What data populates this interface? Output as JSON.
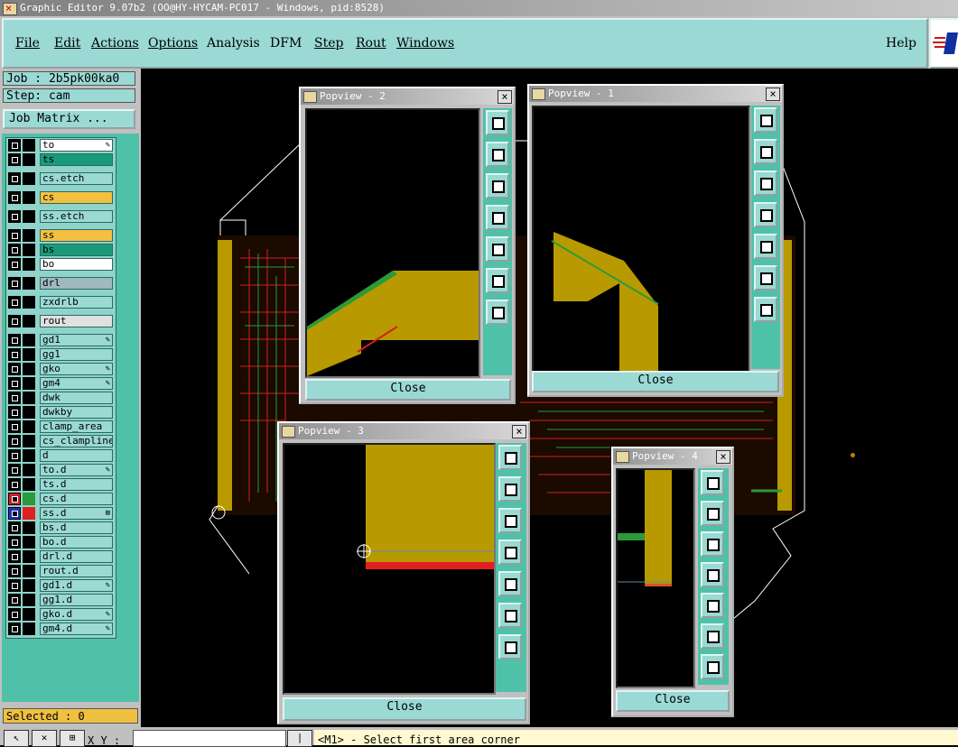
{
  "window": {
    "title": "Graphic Editor 9.07b2 (OO@HY-HYCAM-PC017 - Windows, pid:8528)"
  },
  "menu": {
    "file": "File",
    "edit": "Edit",
    "actions": "Actions",
    "options": "Options",
    "analysis": "Analysis",
    "dfm": "DFM",
    "step": "Step",
    "rout": "Rout",
    "windows": "Windows",
    "help": "Help"
  },
  "job": {
    "label": "Job : 2b5pk00ka0",
    "step_label": "Step: cam",
    "matrix_button": "Job Matrix ..."
  },
  "layers": [
    {
      "name": "to",
      "color": "#ffffff",
      "mark": "✎"
    },
    {
      "name": "ts",
      "color": "#1a9a7a",
      "mark": ""
    },
    {
      "name": "cs.etch",
      "color": "#9ad9d4",
      "mark": ""
    },
    {
      "name": "cs",
      "color": "#f4c040",
      "mark": ""
    },
    {
      "name": "ss.etch",
      "color": "#9ad9d4",
      "mark": ""
    },
    {
      "name": "ss",
      "color": "#f4c040",
      "mark": ""
    },
    {
      "name": "bs",
      "color": "#1a9a7a",
      "mark": ""
    },
    {
      "name": "bo",
      "color": "#ffffff",
      "mark": ""
    },
    {
      "name": "drl",
      "color": "#a0b8c0",
      "mark": ""
    },
    {
      "name": "zxdrlb",
      "color": "#9ad9d4",
      "mark": ""
    },
    {
      "name": "rout",
      "color": "#e0e0e0",
      "mark": ""
    },
    {
      "name": "gd1",
      "color": "#9ad9d4",
      "mark": "✎"
    },
    {
      "name": "gg1",
      "color": "#9ad9d4",
      "mark": ""
    },
    {
      "name": "gko",
      "color": "#9ad9d4",
      "mark": "✎"
    },
    {
      "name": "gm4",
      "color": "#9ad9d4",
      "mark": "✎"
    },
    {
      "name": "dwk",
      "color": "#9ad9d4",
      "mark": ""
    },
    {
      "name": "dwkby",
      "color": "#9ad9d4",
      "mark": ""
    },
    {
      "name": "clamp_area",
      "color": "#9ad9d4",
      "mark": ""
    },
    {
      "name": "cs_clampline",
      "color": "#9ad9d4",
      "mark": ""
    },
    {
      "name": "d",
      "color": "#9ad9d4",
      "mark": ""
    },
    {
      "name": "to.d",
      "color": "#9ad9d4",
      "mark": "✎"
    },
    {
      "name": "ts.d",
      "color": "#9ad9d4",
      "mark": ""
    },
    {
      "name": "cs.d",
      "color": "#9ad9d4",
      "mark": ""
    },
    {
      "name": "ss.d",
      "color": "#9ad9d4",
      "mark": "⊞"
    },
    {
      "name": "bs.d",
      "color": "#9ad9d4",
      "mark": ""
    },
    {
      "name": "bo.d",
      "color": "#9ad9d4",
      "mark": ""
    },
    {
      "name": "drl.d",
      "color": "#9ad9d4",
      "mark": ""
    },
    {
      "name": "rout.d",
      "color": "#9ad9d4",
      "mark": ""
    },
    {
      "name": "gd1.d",
      "color": "#9ad9d4",
      "mark": "✎"
    },
    {
      "name": "gg1.d",
      "color": "#9ad9d4",
      "mark": ""
    },
    {
      "name": "gko.d",
      "color": "#9ad9d4",
      "mark": "✎"
    },
    {
      "name": "gm4.d",
      "color": "#9ad9d4",
      "mark": "✎"
    }
  ],
  "status": {
    "selected": "Selected : 0",
    "xy_label": "X Y :",
    "prompt": "<M1> - Select first area corner"
  },
  "popviews": {
    "p1": {
      "title": "Popview - 1",
      "close": "Close"
    },
    "p2": {
      "title": "Popview - 2",
      "close": "Close"
    },
    "p3": {
      "title": "Popview - 3",
      "close": "Close"
    },
    "p4": {
      "title": "Popview - 4",
      "close": "Close"
    }
  },
  "colors": {
    "panel": "#9ad9d4",
    "accent": "#4fc1a9",
    "copper": "#b89a00",
    "trace_red": "#e02020",
    "trace_green": "#2a9a3a"
  }
}
